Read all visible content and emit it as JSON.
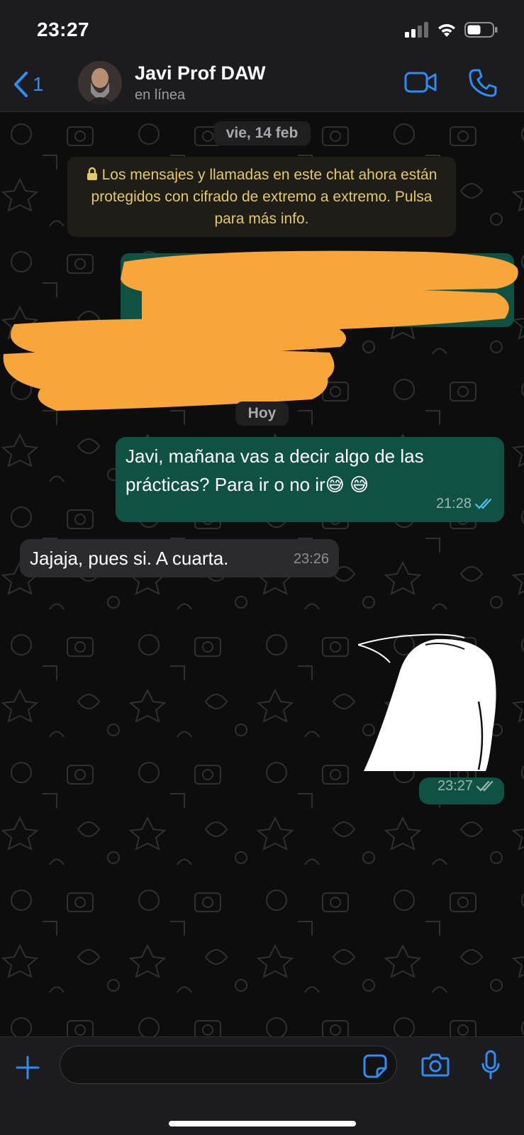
{
  "status_bar": {
    "time": "23:27",
    "icons": [
      "signal-icon",
      "wifi-icon",
      "battery-icon"
    ]
  },
  "header": {
    "back_count": "1",
    "contact_name": "Javi Prof DAW",
    "contact_status": "en línea",
    "icons": [
      "chevron-left-icon",
      "video-call-icon",
      "phone-icon"
    ]
  },
  "chat": {
    "date_old": "vie, 14 feb",
    "encryption_notice": "Los mensajes y llamadas en este chat ahora están protegidos con cifrado de extremo a extremo. Pulsa para más info.",
    "date_today": "Hoy",
    "messages": [
      {
        "direction": "outgoing",
        "line1": "Javi, mañana vas a decir algo de las",
        "line2": "prácticas? Para ir o no ir😅 😅",
        "time": "21:28",
        "read_status": "read"
      },
      {
        "direction": "incoming",
        "text": "Jajaja, pues si. A cuarta.",
        "time": "23:26"
      },
      {
        "direction": "outgoing",
        "type": "sticker",
        "time": "23:27",
        "read_status": "delivered"
      }
    ]
  },
  "composer": {
    "placeholder": "",
    "icons": [
      "plus-icon",
      "sticker-icon",
      "camera-icon",
      "microphone-icon"
    ]
  },
  "colors": {
    "accent": "#2f8cf5",
    "outgoing_bubble": "#0f5143",
    "incoming_bubble": "#2b2b2e",
    "notice_text": "#e5c965",
    "redaction": "#f8a53a"
  }
}
